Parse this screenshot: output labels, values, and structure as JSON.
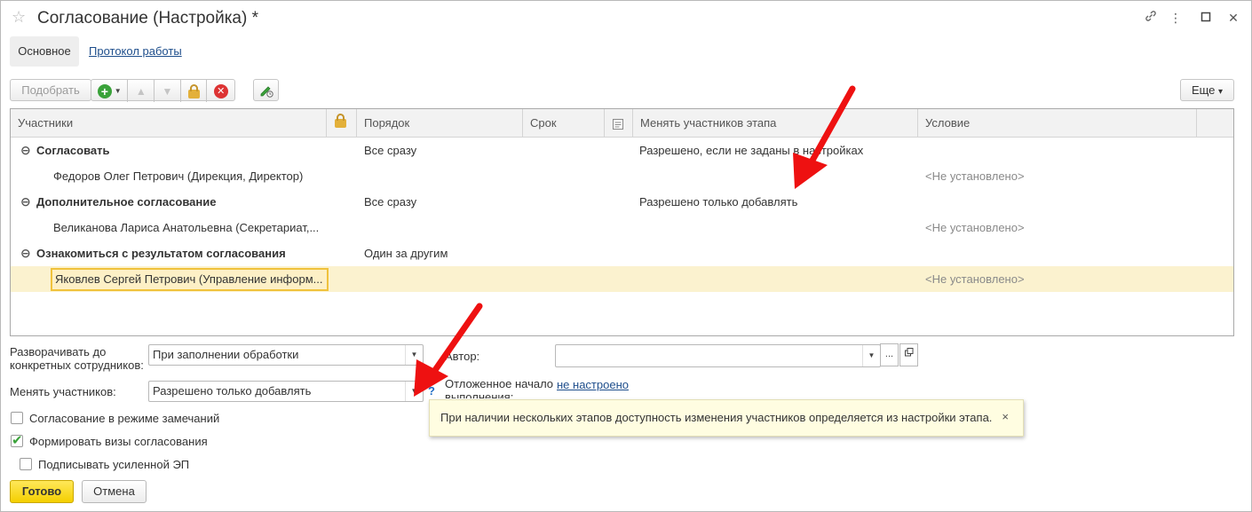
{
  "window": {
    "title": "Согласование (Настройка) *",
    "icons": [
      "star-icon",
      "link-icon",
      "more-vertical-icon",
      "maximize-icon",
      "close-icon"
    ]
  },
  "tabs": [
    {
      "label": "Основное",
      "active": true
    },
    {
      "label": "Протокол работы",
      "active": false
    }
  ],
  "toolbar": {
    "pick_label": "Подобрать",
    "more_label": "Еще",
    "more_caret": "▾"
  },
  "table": {
    "columns": [
      "Участники",
      "",
      "Порядок",
      "Срок",
      "",
      "Менять участников этапа",
      "Условие"
    ],
    "rows": [
      {
        "type": "group",
        "name": "Согласовать",
        "order": "Все сразу",
        "change": "Разрешено, если не заданы в настройках",
        "condition": ""
      },
      {
        "type": "item",
        "name": "Федоров Олег Петрович (Дирекция, Директор)",
        "order": "",
        "change": "",
        "condition": "<Не установлено>"
      },
      {
        "type": "group",
        "name": "Дополнительное согласование",
        "order": "Все сразу",
        "change": "Разрешено только добавлять",
        "condition": ""
      },
      {
        "type": "item",
        "name": "Великанова Лариса Анатольевна (Секретариат,...",
        "order": "",
        "change": "",
        "condition": "<Не установлено>"
      },
      {
        "type": "group",
        "name": "Ознакомиться с результатом согласования",
        "order": "Один за другим",
        "change": "",
        "condition": ""
      },
      {
        "type": "item",
        "name": "Яковлев Сергей Петрович (Управление информ...",
        "order": "",
        "change": "",
        "condition": "<Не установлено>",
        "selected": true
      }
    ]
  },
  "form": {
    "expand_label_line1": "Разворачивать до",
    "expand_label_line2": "конкретных сотрудников:",
    "expand_value": "При заполнении обработки",
    "change_label": "Менять участников:",
    "change_value": "Разрешено только добавлять",
    "help_mark": "?",
    "author_label": "Автор:",
    "author_value": "",
    "delayed_label_line1": "Отложенное начало",
    "delayed_label_line2": "выполнения:",
    "delayed_value": "не настроено",
    "tooltip_text": "При наличии нескольких этапов доступность изменения участников определяется из настройки этапа.",
    "tooltip_close": "×"
  },
  "options": [
    {
      "label": "Согласование в режиме замечаний",
      "checked": false
    },
    {
      "label": "Формировать визы согласования",
      "checked": true
    },
    {
      "label": "Подписывать усиленной ЭП",
      "checked": false
    }
  ],
  "buttons": {
    "ok": "Готово",
    "cancel": "Отмена"
  },
  "colors": {
    "accent_yellow": "#f4cf00",
    "selection": "#fbf2cf",
    "link": "#1e4e8c",
    "annotation_arrow": "#ee1111"
  }
}
